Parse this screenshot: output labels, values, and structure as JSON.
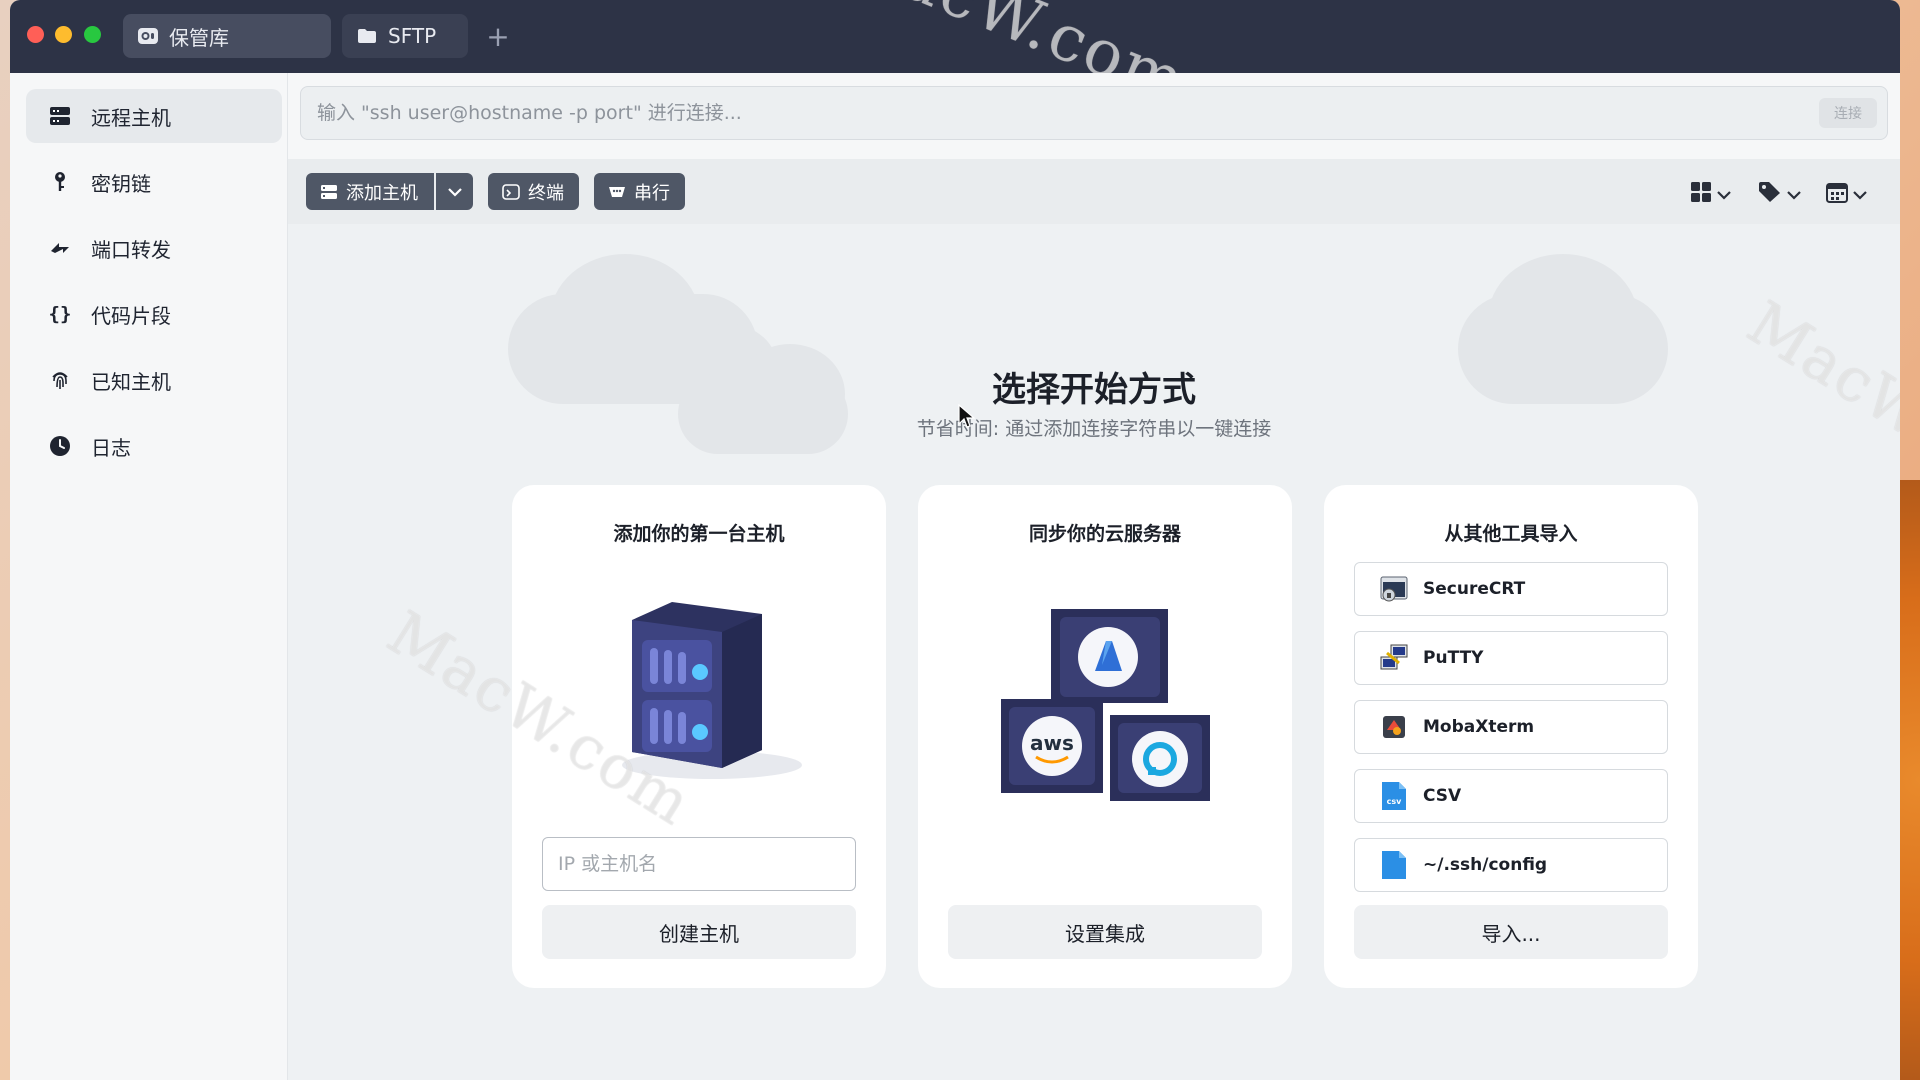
{
  "window": {
    "tabs": [
      {
        "label": "保管库",
        "icon": "vault-icon"
      },
      {
        "label": "SFTP",
        "icon": "folder-icon"
      }
    ],
    "new_tab_label": "+"
  },
  "watermark": "MacW.com",
  "sidebar": {
    "items": [
      {
        "label": "远程主机",
        "icon": "server-icon",
        "active": true
      },
      {
        "label": "密钥链",
        "icon": "key-icon"
      },
      {
        "label": "端口转发",
        "icon": "port-forward-icon"
      },
      {
        "label": "代码片段",
        "icon": "braces-icon"
      },
      {
        "label": "已知主机",
        "icon": "fingerprint-icon"
      },
      {
        "label": "日志",
        "icon": "clock-icon"
      }
    ]
  },
  "command_bar": {
    "placeholder": "输入 \"ssh user@hostname -p port\" 进行连接...",
    "connect_label": "连接"
  },
  "toolbar": {
    "add_host_label": "添加主机",
    "terminal_label": "终端",
    "serial_label": "串行"
  },
  "empty_state": {
    "title": "选择开始方式",
    "subtitle": "节省时间: 通过添加连接字符串以一键连接"
  },
  "cards": {
    "add_host": {
      "title": "添加你的第一台主机",
      "input_placeholder": "IP 或主机名",
      "button": "创建主机"
    },
    "cloud_sync": {
      "title": "同步你的云服务器",
      "button": "设置集成",
      "provider_aws": "aws"
    },
    "import": {
      "title": "从其他工具导入",
      "items": [
        "SecureCRT",
        "PuTTY",
        "MobaXterm",
        "CSV",
        "~/.ssh/config"
      ],
      "csv_icon_text": "csv",
      "button": "导入..."
    }
  },
  "colors": {
    "titlebar": "#2d3346",
    "toolbar_button": "#4f5766",
    "accent_blue": "#4a7cff"
  }
}
